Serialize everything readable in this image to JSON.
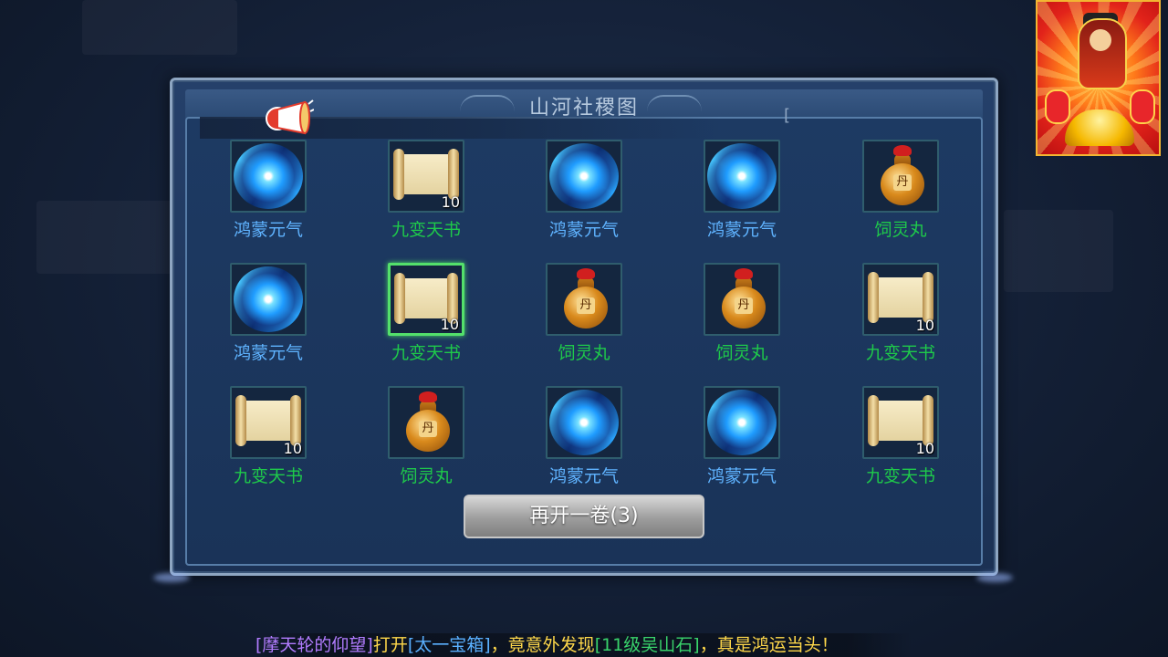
{
  "panel": {
    "title": "山河社稷图",
    "bracket": "["
  },
  "items": [
    {
      "name": "鸿蒙元气",
      "type": "swirl",
      "count": "",
      "color": "blue"
    },
    {
      "name": "九变天书",
      "type": "scroll",
      "count": "10",
      "color": "green"
    },
    {
      "name": "鸿蒙元气",
      "type": "swirl",
      "count": "",
      "color": "blue"
    },
    {
      "name": "鸿蒙元气",
      "type": "swirl",
      "count": "",
      "color": "blue"
    },
    {
      "name": "饲灵丸",
      "type": "gourd",
      "count": "",
      "color": "green"
    },
    {
      "name": "鸿蒙元气",
      "type": "swirl",
      "count": "",
      "color": "blue"
    },
    {
      "name": "九变天书",
      "type": "scroll",
      "count": "10",
      "color": "green",
      "selected": true
    },
    {
      "name": "饲灵丸",
      "type": "gourd",
      "count": "",
      "color": "green"
    },
    {
      "name": "饲灵丸",
      "type": "gourd",
      "count": "",
      "color": "green"
    },
    {
      "name": "九变天书",
      "type": "scroll",
      "count": "10",
      "color": "green"
    },
    {
      "name": "九变天书",
      "type": "scroll",
      "count": "10",
      "color": "green"
    },
    {
      "name": "饲灵丸",
      "type": "gourd",
      "count": "",
      "color": "green"
    },
    {
      "name": "鸿蒙元气",
      "type": "swirl",
      "count": "",
      "color": "blue"
    },
    {
      "name": "鸿蒙元气",
      "type": "swirl",
      "count": "",
      "color": "blue"
    },
    {
      "name": "九变天书",
      "type": "scroll",
      "count": "10",
      "color": "green"
    }
  ],
  "gourd_mark": "丹",
  "button": {
    "reopen_label": "再开一卷(3)"
  },
  "ticker": {
    "player": "[摩天轮的仰望]",
    "action": "打开",
    "chest": "[太一宝箱]",
    "middle": "，竟意外发现",
    "reward": "[11级吴山石]",
    "ending": "，真是鸿运当头！"
  },
  "colors": {
    "green_label": "#1ec94a",
    "blue_label": "#5fb3ff",
    "selected_border": "#53e06b",
    "button": "#9d9d9d"
  }
}
